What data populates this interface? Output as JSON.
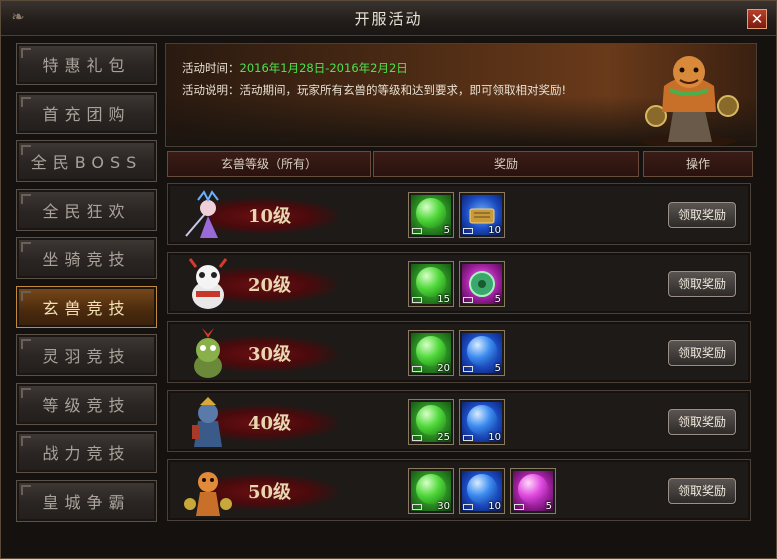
{
  "window": {
    "title": "开服活动",
    "close_label": "✕"
  },
  "sidebar": {
    "items": [
      {
        "label": "特惠礼包",
        "active": false
      },
      {
        "label": "首充团购",
        "active": false
      },
      {
        "label": "全民BOSS",
        "active": false
      },
      {
        "label": "全民狂欢",
        "active": false
      },
      {
        "label": "坐骑竞技",
        "active": false
      },
      {
        "label": "玄兽竞技",
        "active": true
      },
      {
        "label": "灵羽竞技",
        "active": false
      },
      {
        "label": "等级竞技",
        "active": false
      },
      {
        "label": "战力竞技",
        "active": false
      },
      {
        "label": "皇城争霸",
        "active": false
      }
    ]
  },
  "activity": {
    "time_label": "活动时间：",
    "time_value": "2016年1月28日-2016年2月2日",
    "desc_label": "活动说明：",
    "desc_value": "活动期间，玩家所有玄兽的等级和达到要求，即可领取相对奖励!"
  },
  "table": {
    "headers": {
      "level": "玄兽等级（所有）",
      "reward": "奖励",
      "action": "操作"
    },
    "button_label": "领取奖励",
    "rows": [
      {
        "level": "10级",
        "items": [
          {
            "type": "green",
            "icon": "paw-orb-icon",
            "count": "5"
          },
          {
            "type": "blue",
            "icon": "scroll-icon",
            "count": "10"
          }
        ]
      },
      {
        "level": "20级",
        "items": [
          {
            "type": "green",
            "icon": "paw-orb-icon",
            "count": "15"
          },
          {
            "type": "purple",
            "icon": "jade-icon",
            "count": "5"
          }
        ]
      },
      {
        "level": "30级",
        "items": [
          {
            "type": "green",
            "icon": "paw-orb-icon",
            "count": "20"
          },
          {
            "type": "blue",
            "icon": "paw-orb-icon",
            "count": "5"
          }
        ]
      },
      {
        "level": "40级",
        "items": [
          {
            "type": "green",
            "icon": "paw-orb-icon",
            "count": "25"
          },
          {
            "type": "blue",
            "icon": "paw-orb-icon",
            "count": "10"
          }
        ]
      },
      {
        "level": "50级",
        "items": [
          {
            "type": "green",
            "icon": "paw-orb-icon",
            "count": "30"
          },
          {
            "type": "blue",
            "icon": "paw-orb-icon",
            "count": "10"
          },
          {
            "type": "purple",
            "icon": "paw-orb-icon",
            "count": "5"
          }
        ]
      }
    ]
  },
  "colors": {
    "accent_green": "#4ee34e",
    "active_tab": "#7a4a1a",
    "level_brush": "#6a0f12"
  }
}
